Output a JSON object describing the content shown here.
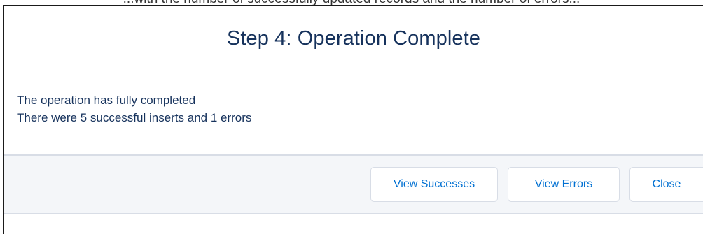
{
  "page": {
    "cropped_caption": "...with the number of successfully updated records and the number of errors..."
  },
  "modal": {
    "title": "Step 4: Operation Complete",
    "body_lines": [
      "The operation has fully completed",
      "There were 5 successful inserts and 1 errors"
    ],
    "buttons": {
      "view_successes": "View Successes",
      "view_errors": "View Errors",
      "close": "Close"
    }
  },
  "colors": {
    "title_text": "#16325c",
    "button_text": "#0070d2",
    "footer_bg": "#f4f6f9",
    "divider": "#d8dde6"
  }
}
